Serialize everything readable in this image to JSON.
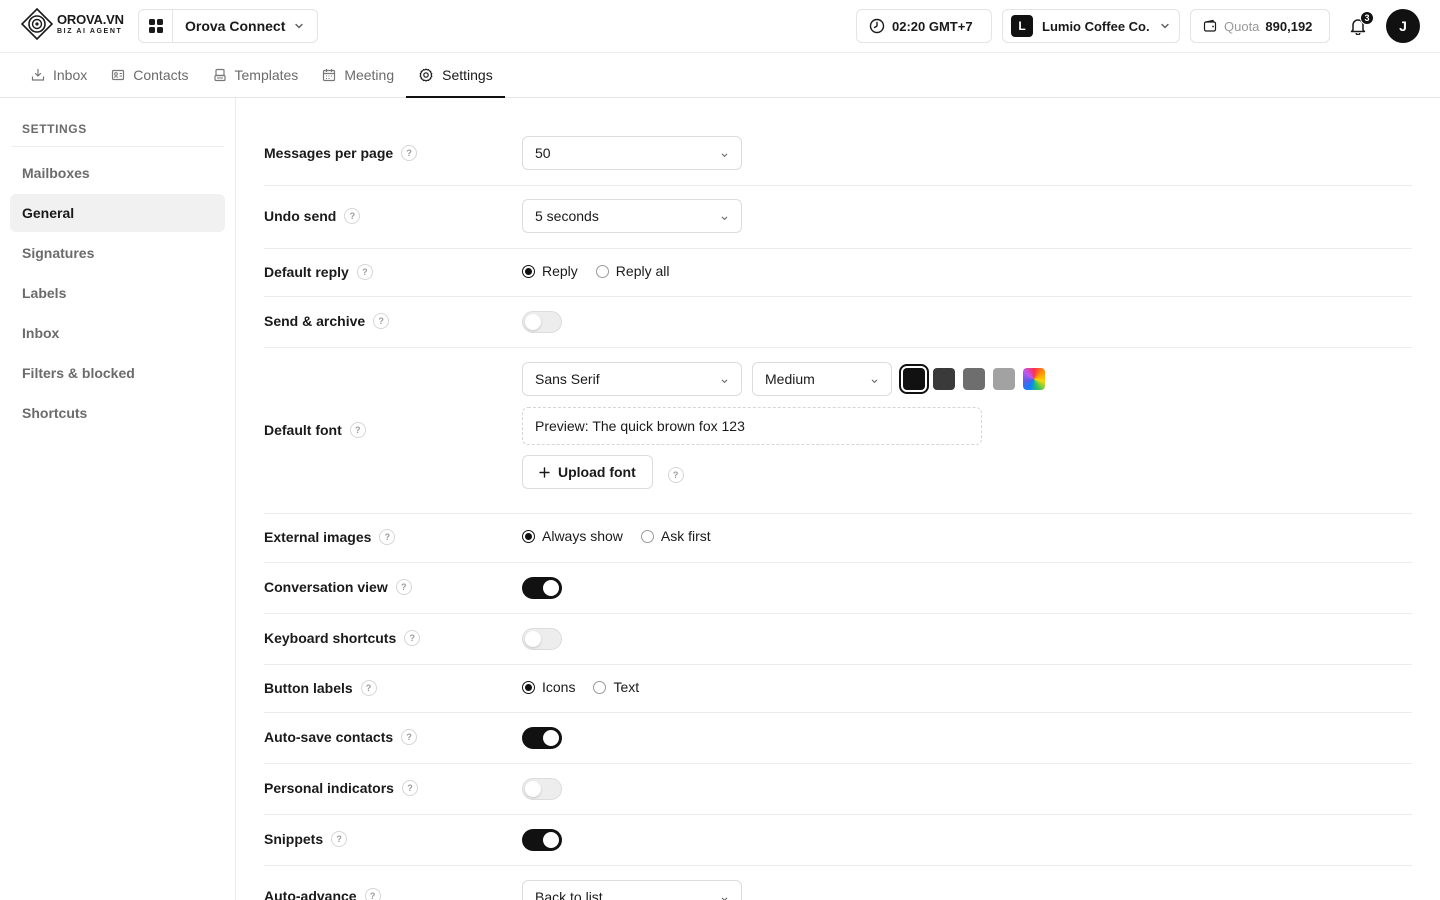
{
  "brand": {
    "name": "OROVA.VN",
    "tagline": "BIZ AI AGENT"
  },
  "app_switcher": {
    "name": "Orova Connect"
  },
  "header": {
    "time": "02:20 GMT+7",
    "org": {
      "initial": "L",
      "name": "Lumio Coffee Co."
    },
    "quota": {
      "label": "Quota",
      "value": "890,192"
    },
    "notifications_count": "3",
    "avatar_initial": "J"
  },
  "tabs": [
    {
      "label": "Inbox",
      "icon": "inbox-icon"
    },
    {
      "label": "Contacts",
      "icon": "contacts-icon"
    },
    {
      "label": "Templates",
      "icon": "templates-icon"
    },
    {
      "label": "Meeting",
      "icon": "calendar-icon"
    },
    {
      "label": "Settings",
      "icon": "gear-icon",
      "active": true
    }
  ],
  "sidebar": {
    "heading": "SETTINGS",
    "items": [
      {
        "label": "Mailboxes"
      },
      {
        "label": "General",
        "active": true
      },
      {
        "label": "Signatures"
      },
      {
        "label": "Labels"
      },
      {
        "label": "Inbox"
      },
      {
        "label": "Filters & blocked"
      },
      {
        "label": "Shortcuts"
      }
    ]
  },
  "settings": {
    "messages_per_page": {
      "label": "Messages per page",
      "value": "50"
    },
    "undo_send": {
      "label": "Undo send",
      "value": "5 seconds"
    },
    "default_reply": {
      "label": "Default reply",
      "options": [
        "Reply",
        "Reply all"
      ],
      "selected": "Reply"
    },
    "send_archive": {
      "label": "Send & archive",
      "enabled": false
    },
    "default_font": {
      "label": "Default font",
      "family": "Sans Serif",
      "size": "Medium",
      "colors": [
        "#111111",
        "#3a3a3a",
        "#6e6e6e",
        "#a2a2a2",
        "rainbow"
      ],
      "selected_color": "#111111",
      "preview": "Preview: The quick brown fox 123",
      "upload_label": "Upload font"
    },
    "external_images": {
      "label": "External images",
      "options": [
        "Always show",
        "Ask first"
      ],
      "selected": "Always show"
    },
    "conversation_view": {
      "label": "Conversation view",
      "enabled": true
    },
    "keyboard_shortcuts": {
      "label": "Keyboard shortcuts",
      "enabled": false
    },
    "button_labels": {
      "label": "Button labels",
      "options": [
        "Icons",
        "Text"
      ],
      "selected": "Icons"
    },
    "auto_save_contacts": {
      "label": "Auto-save contacts",
      "enabled": true
    },
    "personal_indicators": {
      "label": "Personal indicators",
      "enabled": false
    },
    "snippets": {
      "label": "Snippets",
      "enabled": true
    },
    "auto_advance": {
      "label": "Auto-advance",
      "value": "Back to list"
    }
  },
  "help_glyph": "?"
}
